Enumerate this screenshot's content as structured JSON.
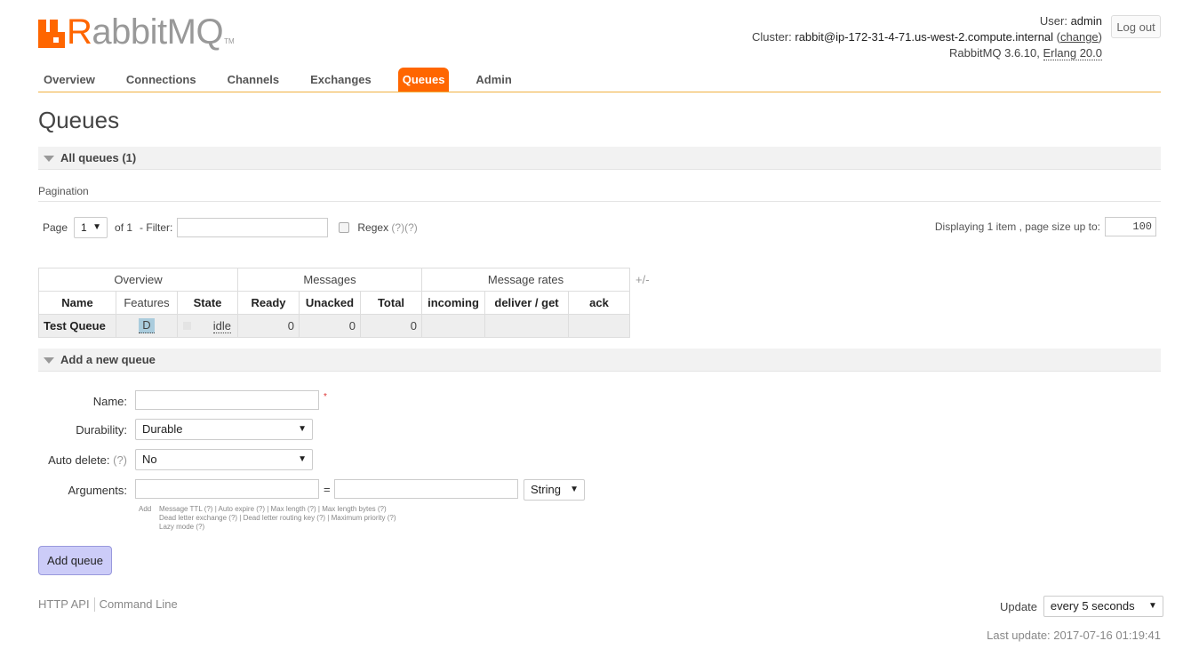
{
  "logo": {
    "text_r": "R",
    "text_rest": "abbitMQ",
    "tm": "TM"
  },
  "header": {
    "user_label": "User:",
    "user": "admin",
    "cluster_label": "Cluster:",
    "cluster": "rabbit@ip-172-31-4-71.us-west-2.compute.internal",
    "change": "change",
    "version": "RabbitMQ 3.6.10,",
    "erlang": "Erlang 20.0",
    "logout": "Log out"
  },
  "nav": [
    "Overview",
    "Connections",
    "Channels",
    "Exchanges",
    "Queues",
    "Admin"
  ],
  "nav_active": "Queues",
  "page_title": "Queues",
  "all_queues": {
    "title": "All queues (1)"
  },
  "pagination": {
    "label": "Pagination",
    "page_label": "Page",
    "page_value": "1",
    "of": "of 1",
    "filter_label": "- Filter:",
    "regex": "Regex",
    "help1": "(?)(?)",
    "displaying": "Displaying 1 item , page size up to:",
    "page_size": "100"
  },
  "table": {
    "groups": [
      "Overview",
      "Messages",
      "Message rates"
    ],
    "columns": [
      "Name",
      "Features",
      "State",
      "Ready",
      "Unacked",
      "Total",
      "incoming",
      "deliver / get",
      "ack"
    ],
    "rows": [
      {
        "name": "Test Queue",
        "features": "D",
        "state": "idle",
        "ready": "0",
        "unacked": "0",
        "total": "0",
        "incoming": "",
        "deliver_get": "",
        "ack": ""
      }
    ],
    "toggle": "+/-"
  },
  "add_queue": {
    "title": "Add a new queue",
    "name_label": "Name:",
    "required": "*",
    "durability_label": "Durability:",
    "durability_value": "Durable",
    "auto_delete_label": "Auto delete:",
    "auto_delete_help": "(?)",
    "auto_delete_value": "No",
    "arguments_label": "Arguments:",
    "equals": "=",
    "arg_type": "String",
    "add": "Add",
    "help_line1": "Message TTL (?) | Auto expire (?) | Max length (?) | Max length bytes (?)",
    "help_line2": "Dead letter exchange (?) | Dead letter routing key (?) | Maximum priority (?)",
    "help_line3": "Lazy mode (?)",
    "button": "Add queue"
  },
  "footer": {
    "http_api": "HTTP API",
    "command_line": "Command Line",
    "update_label": "Update",
    "update_value": "every 5 seconds",
    "last_update": "Last update: 2017-07-16 01:19:41"
  },
  "colors": {
    "accent": "#ff6600",
    "button": "#ccccf8"
  }
}
